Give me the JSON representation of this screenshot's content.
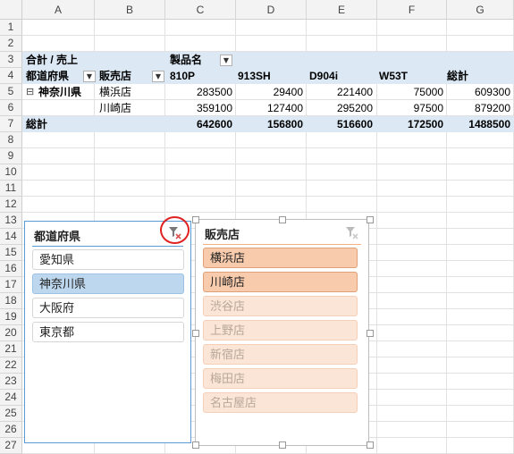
{
  "columns": [
    "A",
    "B",
    "C",
    "D",
    "E",
    "F",
    "G"
  ],
  "rows": [
    "1",
    "2",
    "3",
    "4",
    "5",
    "6",
    "7",
    "8",
    "9",
    "10",
    "11",
    "12",
    "13",
    "14",
    "15",
    "16",
    "17",
    "18",
    "19",
    "20",
    "21",
    "22",
    "23",
    "24",
    "25",
    "26",
    "27"
  ],
  "pivot": {
    "corner_label": "合計 / 売上",
    "product_label": "製品名",
    "pref_header": "都道府県",
    "store_header": "販売店",
    "products": [
      "810P",
      "913SH",
      "D904i",
      "W53T",
      "総計"
    ],
    "group": "神奈川県",
    "collapse_glyph": "⊟",
    "rows": [
      {
        "store": "横浜店",
        "values": [
          "283500",
          "29400",
          "221400",
          "75000",
          "609300"
        ]
      },
      {
        "store": "川崎店",
        "values": [
          "359100",
          "127400",
          "295200",
          "97500",
          "879200"
        ]
      }
    ],
    "total_label": "総計",
    "totals": [
      "642600",
      "156800",
      "516600",
      "172500",
      "1488500"
    ]
  },
  "slicer_pref": {
    "title": "都道府県",
    "items": [
      {
        "label": "愛知県",
        "selected": false
      },
      {
        "label": "神奈川県",
        "selected": true
      },
      {
        "label": "大阪府",
        "selected": false
      },
      {
        "label": "東京都",
        "selected": false
      }
    ]
  },
  "slicer_store": {
    "title": "販売店",
    "items": [
      {
        "label": "横浜店",
        "selected": true
      },
      {
        "label": "川崎店",
        "selected": true
      },
      {
        "label": "渋谷店",
        "selected": false
      },
      {
        "label": "上野店",
        "selected": false
      },
      {
        "label": "新宿店",
        "selected": false
      },
      {
        "label": "梅田店",
        "selected": false
      },
      {
        "label": "名古屋店",
        "selected": false
      }
    ]
  },
  "colors": {
    "pivot_band": "#dce9f5",
    "pref_border": "#5b9bd5",
    "pref_selected": "#bdd7ee",
    "store_border": "#f4b183",
    "store_selected": "#f8cbad",
    "store_unselected": "#fbe5d6",
    "highlight_circle": "#e02222"
  }
}
